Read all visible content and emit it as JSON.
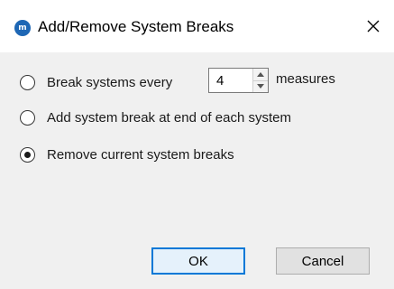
{
  "window": {
    "title": "Add/Remove System Breaks",
    "app_icon_text": "m",
    "accent_color": "#0078d7"
  },
  "options": [
    {
      "label": "Break systems every",
      "selected": false
    },
    {
      "label": "Add system break at end of each system",
      "selected": false
    },
    {
      "label": "Remove current system breaks",
      "selected": true
    }
  ],
  "spinbox": {
    "value": "4",
    "suffix": "measures"
  },
  "buttons": {
    "ok": "OK",
    "cancel": "Cancel"
  }
}
